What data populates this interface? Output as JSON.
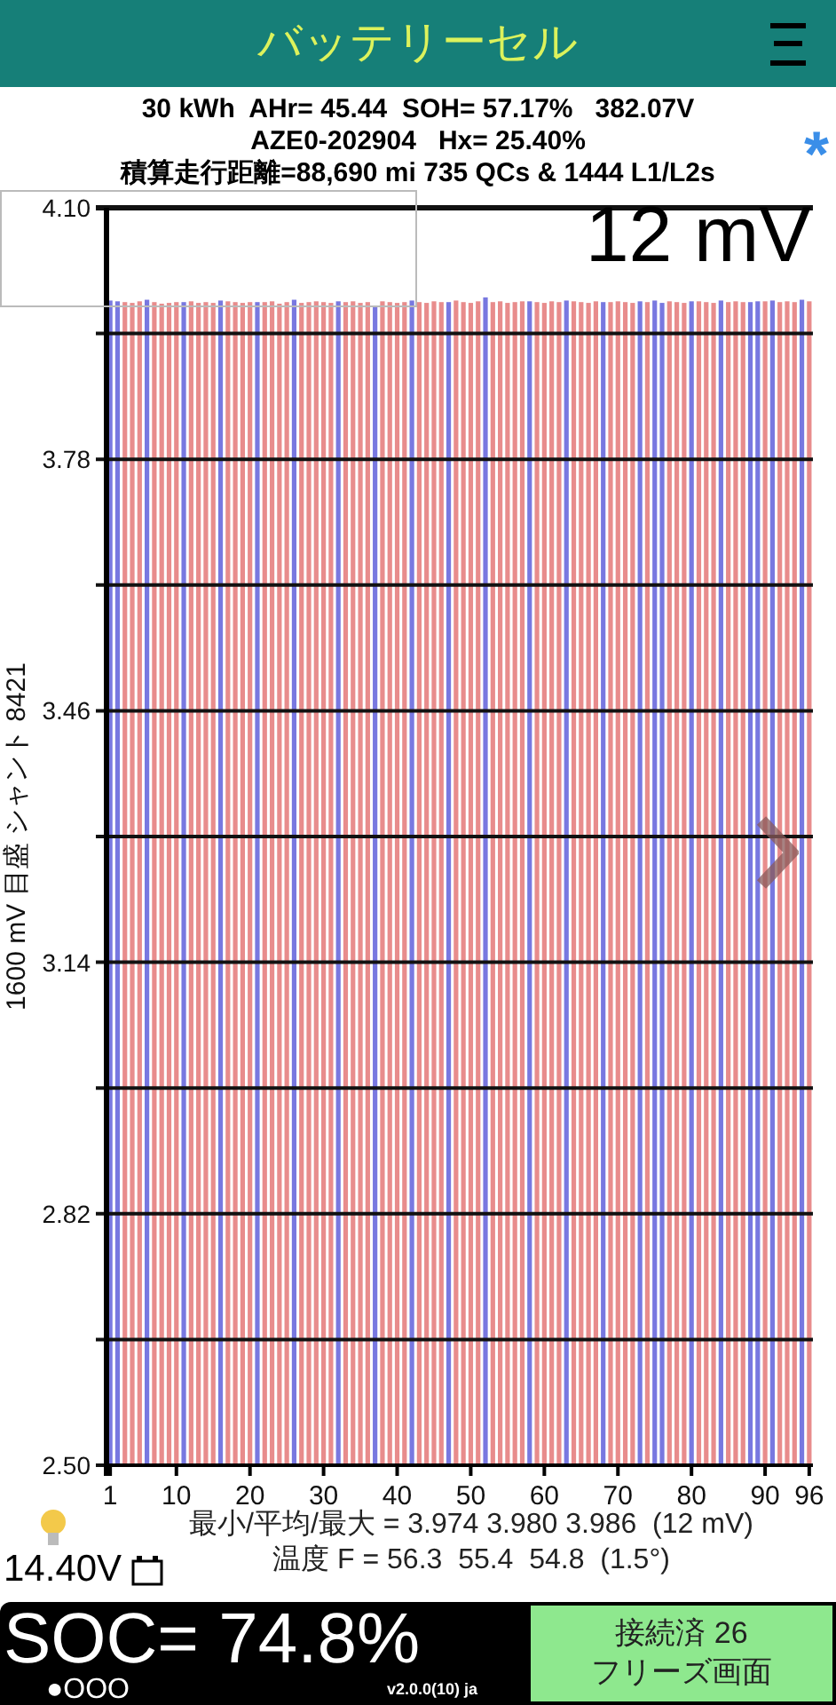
{
  "header": {
    "title": "バッテリーセル"
  },
  "info": {
    "lines": [
      "30 kWh  AHr= 45.44  SOH= 57.17%   382.07V",
      "AZE0-202904   Hx= 25.40%",
      "積算走行距離=88,690 mi 735 QCs & 1444 L1/L2s"
    ],
    "marker": "*"
  },
  "chart": {
    "overlay_value": "12 mV",
    "chart_data": {
      "type": "bar",
      "ylabel": "1600 mV 目盛 シャント 8421",
      "grid": true,
      "x": [
        1,
        2,
        3,
        4,
        5,
        6,
        7,
        8,
        9,
        10,
        11,
        12,
        13,
        14,
        15,
        16,
        17,
        18,
        19,
        20,
        21,
        22,
        23,
        24,
        25,
        26,
        27,
        28,
        29,
        30,
        31,
        32,
        33,
        34,
        35,
        36,
        37,
        38,
        39,
        40,
        41,
        42,
        43,
        44,
        45,
        46,
        47,
        48,
        49,
        50,
        51,
        52,
        53,
        54,
        55,
        56,
        57,
        58,
        59,
        60,
        61,
        62,
        63,
        64,
        65,
        66,
        67,
        68,
        69,
        70,
        71,
        72,
        73,
        74,
        75,
        76,
        77,
        78,
        79,
        80,
        81,
        82,
        83,
        84,
        85,
        86,
        87,
        88,
        89,
        90,
        91,
        92,
        93,
        94,
        95,
        96
      ],
      "series": [
        {
          "color": "#e88c8c",
          "values": [
            null,
            null,
            3.98,
            3.979,
            3.981,
            null,
            3.98,
            3.978,
            3.979,
            3.98,
            null,
            3.981,
            3.979,
            3.98,
            3.979,
            null,
            3.981,
            3.98,
            3.979,
            3.98,
            null,
            3.98,
            3.981,
            3.978,
            3.98,
            null,
            3.979,
            3.98,
            3.981,
            3.98,
            3.979,
            null,
            3.98,
            3.981,
            3.979,
            3.98,
            null,
            3.981,
            3.98,
            3.979,
            3.98,
            null,
            3.98,
            3.979,
            3.981,
            3.98,
            null,
            3.982,
            3.98,
            3.979,
            3.981,
            null,
            3.98,
            3.981,
            3.979,
            3.98,
            3.981,
            null,
            3.98,
            3.979,
            3.981,
            3.98,
            null,
            3.981,
            3.98,
            3.979,
            3.981,
            null,
            3.98,
            3.981,
            3.98,
            3.979,
            null,
            3.98,
            null,
            null,
            3.981,
            3.98,
            3.979,
            null,
            3.981,
            3.98,
            3.979,
            null,
            3.98,
            3.981,
            3.98,
            null,
            null,
            3.981,
            null,
            3.98,
            3.981,
            3.98,
            null,
            3.981
          ]
        },
        {
          "color": "#7878e0",
          "values": [
            3.982,
            3.981,
            null,
            null,
            null,
            3.983,
            null,
            null,
            null,
            null,
            3.98,
            null,
            null,
            null,
            null,
            3.982,
            null,
            null,
            null,
            null,
            3.98,
            null,
            null,
            null,
            null,
            3.983,
            null,
            null,
            null,
            null,
            null,
            3.981,
            null,
            null,
            null,
            null,
            3.974,
            null,
            null,
            null,
            null,
            3.982,
            null,
            null,
            null,
            null,
            3.98,
            null,
            null,
            null,
            null,
            3.986,
            null,
            null,
            null,
            null,
            null,
            3.981,
            null,
            null,
            null,
            null,
            3.982,
            null,
            null,
            null,
            null,
            3.98,
            null,
            null,
            null,
            null,
            3.981,
            null,
            3.982,
            3.979,
            null,
            null,
            null,
            3.981,
            null,
            null,
            null,
            3.982,
            null,
            null,
            null,
            3.98,
            3.981,
            null,
            3.982,
            null,
            null,
            null,
            3.983,
            null
          ]
        }
      ],
      "xlim": [
        0.5,
        96.5
      ],
      "ylim": [
        2.5,
        4.1
      ],
      "yticks": [
        {
          "value": 2.5,
          "label": "2.50"
        },
        {
          "value": 2.82,
          "label": "2.82"
        },
        {
          "value": 3.14,
          "label": "3.14"
        },
        {
          "value": 3.46,
          "label": "3.46"
        },
        {
          "value": 3.78,
          "label": "3.78"
        },
        {
          "value": 4.1,
          "label": "4.10"
        }
      ],
      "xticks": [
        1,
        10,
        20,
        30,
        40,
        50,
        60,
        70,
        80,
        90,
        96
      ]
    }
  },
  "stats": {
    "lines": [
      "最小/平均/最大 = 3.974 3.980 3.986  (12 mV)",
      "温度 F = 56.3  55.4  54.8  (1.5°)"
    ],
    "voltage": "14.40V"
  },
  "footer": {
    "soc": "SOC= 74.8%",
    "dots": "●OOO",
    "version": "v2.0.0(10) ja",
    "status_lines": [
      "接続済 26",
      "フリーズ画面"
    ]
  }
}
